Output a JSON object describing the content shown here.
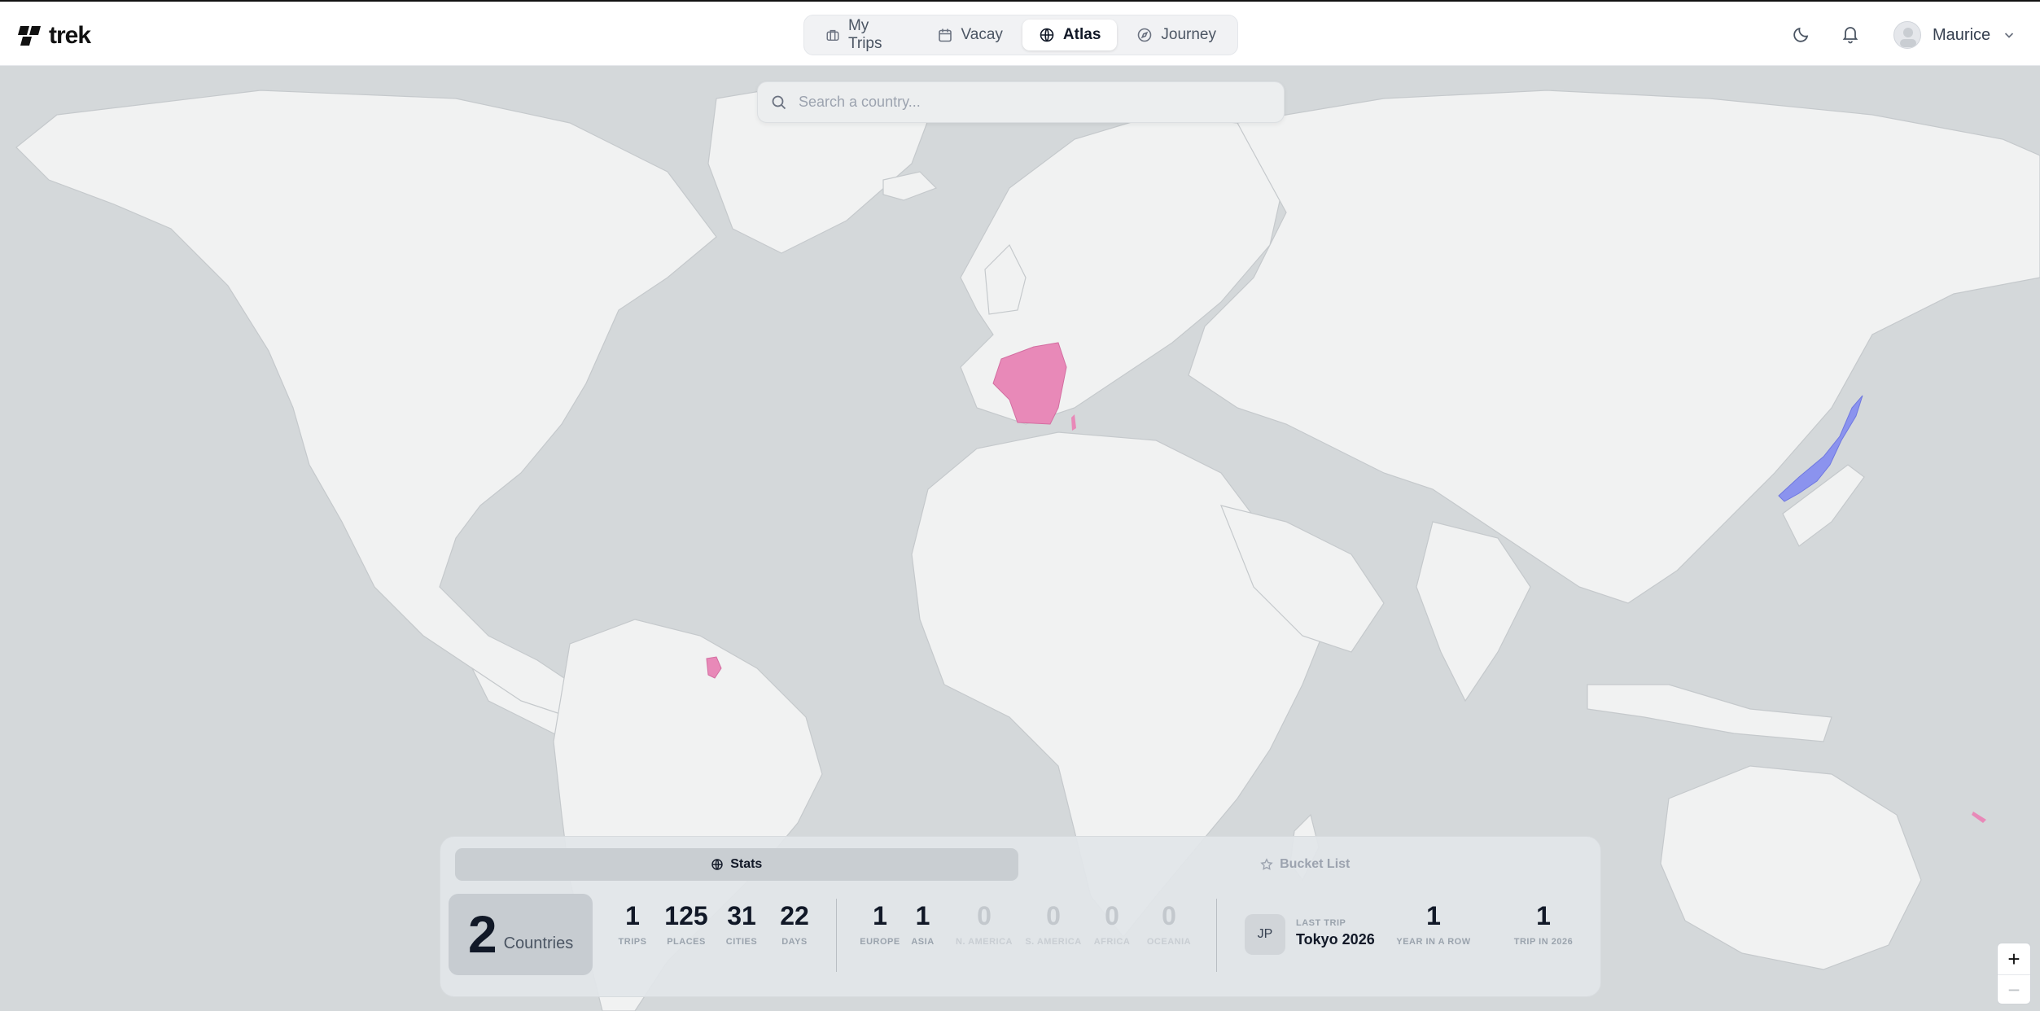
{
  "app": {
    "name": "trek"
  },
  "nav": {
    "items": [
      {
        "label": "My Trips",
        "icon": "briefcase-icon",
        "active": false
      },
      {
        "label": "Vacay",
        "icon": "calendar-icon",
        "active": false
      },
      {
        "label": "Atlas",
        "icon": "globe-icon",
        "active": true
      },
      {
        "label": "Journey",
        "icon": "compass-icon",
        "active": false
      }
    ]
  },
  "header": {
    "user_name": "Maurice"
  },
  "search": {
    "placeholder": "Search a country..."
  },
  "map": {
    "visited_colors": {
      "europe": "#e889b8",
      "asia": "#8b93ee"
    },
    "highlighted_countries": [
      "France",
      "French Guiana",
      "Japan",
      "New Caledonia"
    ]
  },
  "panel": {
    "tabs": {
      "stats": "Stats",
      "bucket": "Bucket List"
    },
    "countries": {
      "value": "2",
      "label": "Countries"
    },
    "stats": [
      {
        "value": "1",
        "label": "TRIPS"
      },
      {
        "value": "125",
        "label": "PLACES"
      },
      {
        "value": "31",
        "label": "CITIES"
      },
      {
        "value": "22",
        "label": "DAYS"
      }
    ],
    "continents": [
      {
        "value": "1",
        "label": "EUROPE"
      },
      {
        "value": "1",
        "label": "ASIA"
      },
      {
        "value": "0",
        "label": "N. AMERICA"
      },
      {
        "value": "0",
        "label": "S. AMERICA"
      },
      {
        "value": "0",
        "label": "AFRICA"
      },
      {
        "value": "0",
        "label": "OCEANIA"
      }
    ],
    "last_trip": {
      "badge": "JP",
      "label": "LAST TRIP",
      "name": "Tokyo 2026"
    },
    "streaks": [
      {
        "value": "1",
        "label": "YEAR IN A ROW"
      },
      {
        "value": "1",
        "label": "TRIP IN 2026"
      }
    ]
  },
  "zoom": {
    "in": "+",
    "out": "−"
  }
}
